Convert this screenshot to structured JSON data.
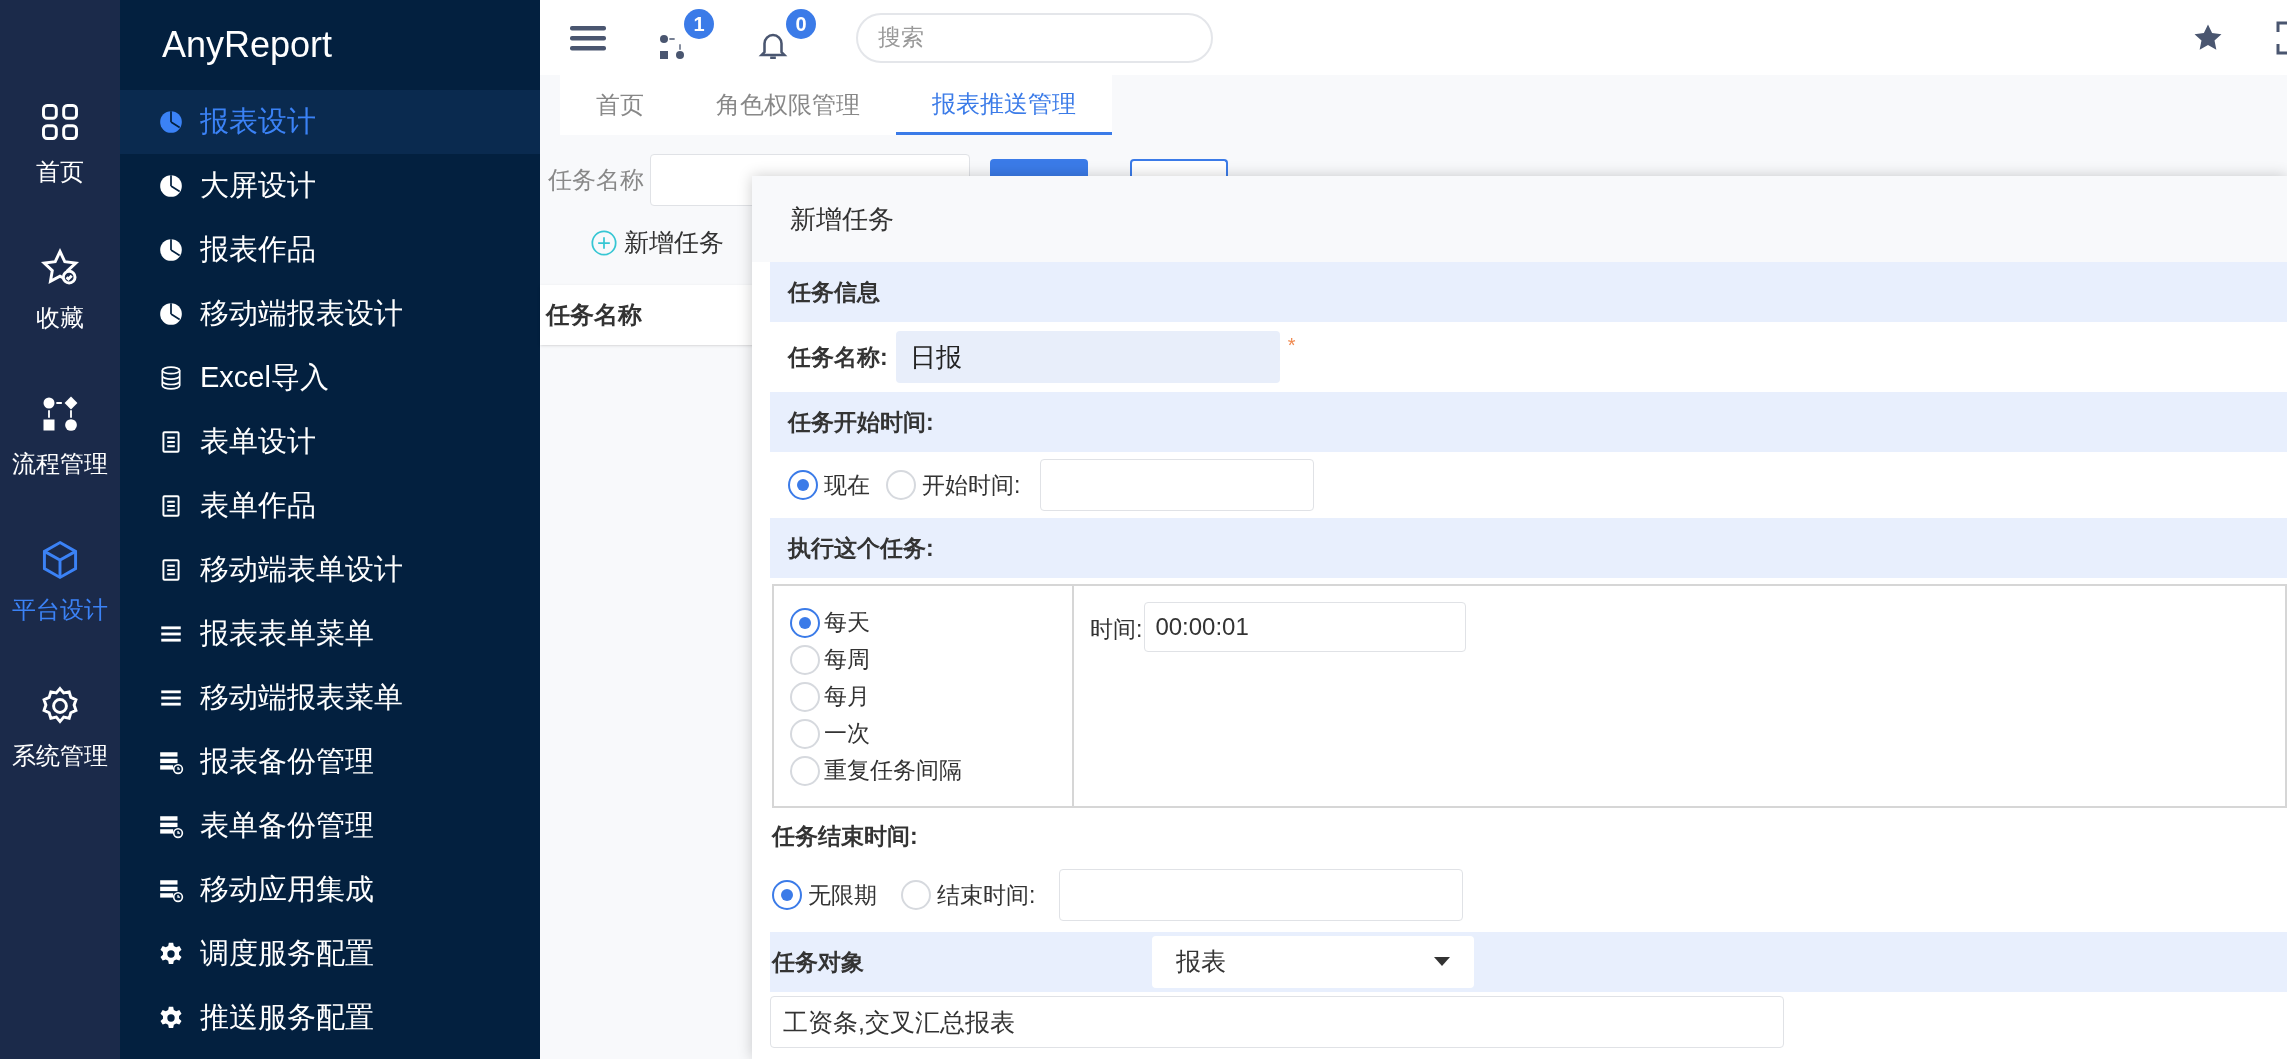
{
  "rail": [
    {
      "label": "首页",
      "kind": "grid",
      "selected": false
    },
    {
      "label": "收藏",
      "kind": "star",
      "selected": false
    },
    {
      "label": "流程管理",
      "kind": "flow",
      "selected": false
    },
    {
      "label": "平台设计",
      "kind": "cube",
      "selected": true
    },
    {
      "label": "系统管理",
      "kind": "gear",
      "selected": false
    }
  ],
  "app_title": "AnyReport",
  "nav": [
    {
      "label": "报表设计",
      "kind": "pie",
      "selected": true
    },
    {
      "label": "大屏设计",
      "kind": "pie",
      "selected": false
    },
    {
      "label": "报表作品",
      "kind": "pie",
      "selected": false
    },
    {
      "label": "移动端报表设计",
      "kind": "pie",
      "selected": false
    },
    {
      "label": "Excel导入",
      "kind": "database",
      "selected": false
    },
    {
      "label": "表单设计",
      "kind": "doc",
      "selected": false
    },
    {
      "label": "表单作品",
      "kind": "doc",
      "selected": false
    },
    {
      "label": "移动端表单设计",
      "kind": "doc",
      "selected": false
    },
    {
      "label": "报表表单菜单",
      "kind": "list",
      "selected": false
    },
    {
      "label": "移动端报表菜单",
      "kind": "list",
      "selected": false
    },
    {
      "label": "报表备份管理",
      "kind": "server",
      "selected": false
    },
    {
      "label": "表单备份管理",
      "kind": "server",
      "selected": false
    },
    {
      "label": "移动应用集成",
      "kind": "server",
      "selected": false
    },
    {
      "label": "调度服务配置",
      "kind": "gear",
      "selected": false
    },
    {
      "label": "推送服务配置",
      "kind": "gear",
      "selected": false
    }
  ],
  "topbar": {
    "flow_badge": "1",
    "bell_badge": "0",
    "search": {
      "placeholder": "搜索"
    }
  },
  "tabs": [
    {
      "label": "首页",
      "selected": false
    },
    {
      "label": "角色权限管理",
      "selected": false
    },
    {
      "label": "报表推送管理",
      "selected": true
    }
  ],
  "filter": {
    "label": "任务名称"
  },
  "add_task": "新增任务",
  "table": {
    "columns": [
      "任务名称"
    ]
  },
  "dialog": {
    "title": "新增任务",
    "info_heading": "任务信息",
    "name_label": "任务名称:",
    "name_value": "日报",
    "required_mark": "*",
    "start_heading": "任务开始时间:",
    "start_options": [
      {
        "label": "现在",
        "selected": true
      },
      {
        "label": "开始时间:",
        "selected": false
      }
    ],
    "run_heading": "执行这个任务:",
    "frequencies": [
      {
        "label": "每天",
        "selected": true
      },
      {
        "label": "每周",
        "selected": false
      },
      {
        "label": "每月",
        "selected": false
      },
      {
        "label": "一次",
        "selected": false
      },
      {
        "label": "重复任务间隔",
        "selected": false
      }
    ],
    "time_label": "时间:",
    "time_value": "00:00:01",
    "end_heading": "任务结束时间:",
    "end_options": [
      {
        "label": "无限期",
        "selected": true
      },
      {
        "label": "结束时间:",
        "selected": false
      }
    ],
    "target_heading": "任务对象",
    "target_select": "报表",
    "target_value": "工资条,交叉汇总报表"
  }
}
